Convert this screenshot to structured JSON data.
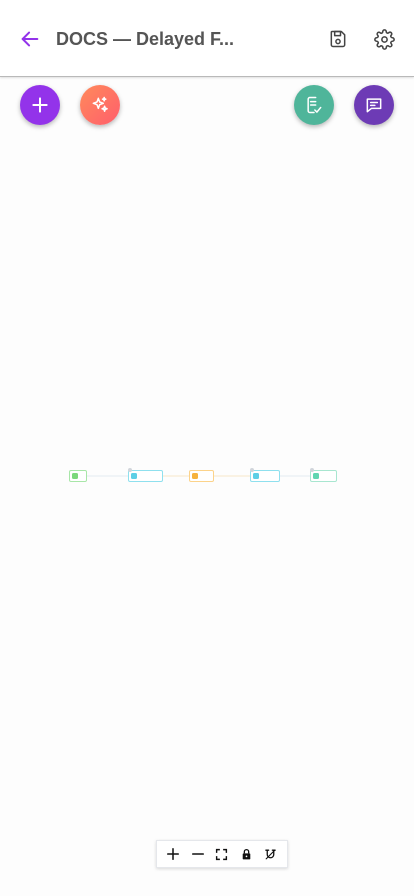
{
  "header": {
    "back_icon": "arrow-left-icon",
    "title": "DOCS — Delayed F...",
    "save_icon": "floppy-disk-icon",
    "settings_icon": "gear-icon",
    "accent_color": "#9333ea"
  },
  "fabs": [
    {
      "name": "add",
      "icon": "plus-icon",
      "color": "#9333ea"
    },
    {
      "name": "ai-generate",
      "icon": "sparkles-icon",
      "color": "#ff6f61"
    },
    {
      "name": "validate",
      "icon": "clipboard-check-icon",
      "color": "#4fb59a"
    },
    {
      "name": "chat",
      "icon": "message-icon",
      "color": "#6d3bb5"
    }
  ],
  "flow": {
    "nodes": [
      {
        "type": "start",
        "color": "#7bd87b"
      },
      {
        "type": "action",
        "color": "#5ccfe6"
      },
      {
        "type": "delay",
        "color": "#f6b23c"
      },
      {
        "type": "action",
        "color": "#5ccfe6"
      },
      {
        "type": "end",
        "color": "#5fd6b0"
      }
    ]
  },
  "controls": [
    {
      "name": "zoom-in",
      "icon": "plus-icon"
    },
    {
      "name": "zoom-out",
      "icon": "minus-icon"
    },
    {
      "name": "fit-view",
      "icon": "fullscreen-icon"
    },
    {
      "name": "lock",
      "icon": "lock-icon"
    },
    {
      "name": "snap",
      "icon": "magnet-icon"
    }
  ]
}
